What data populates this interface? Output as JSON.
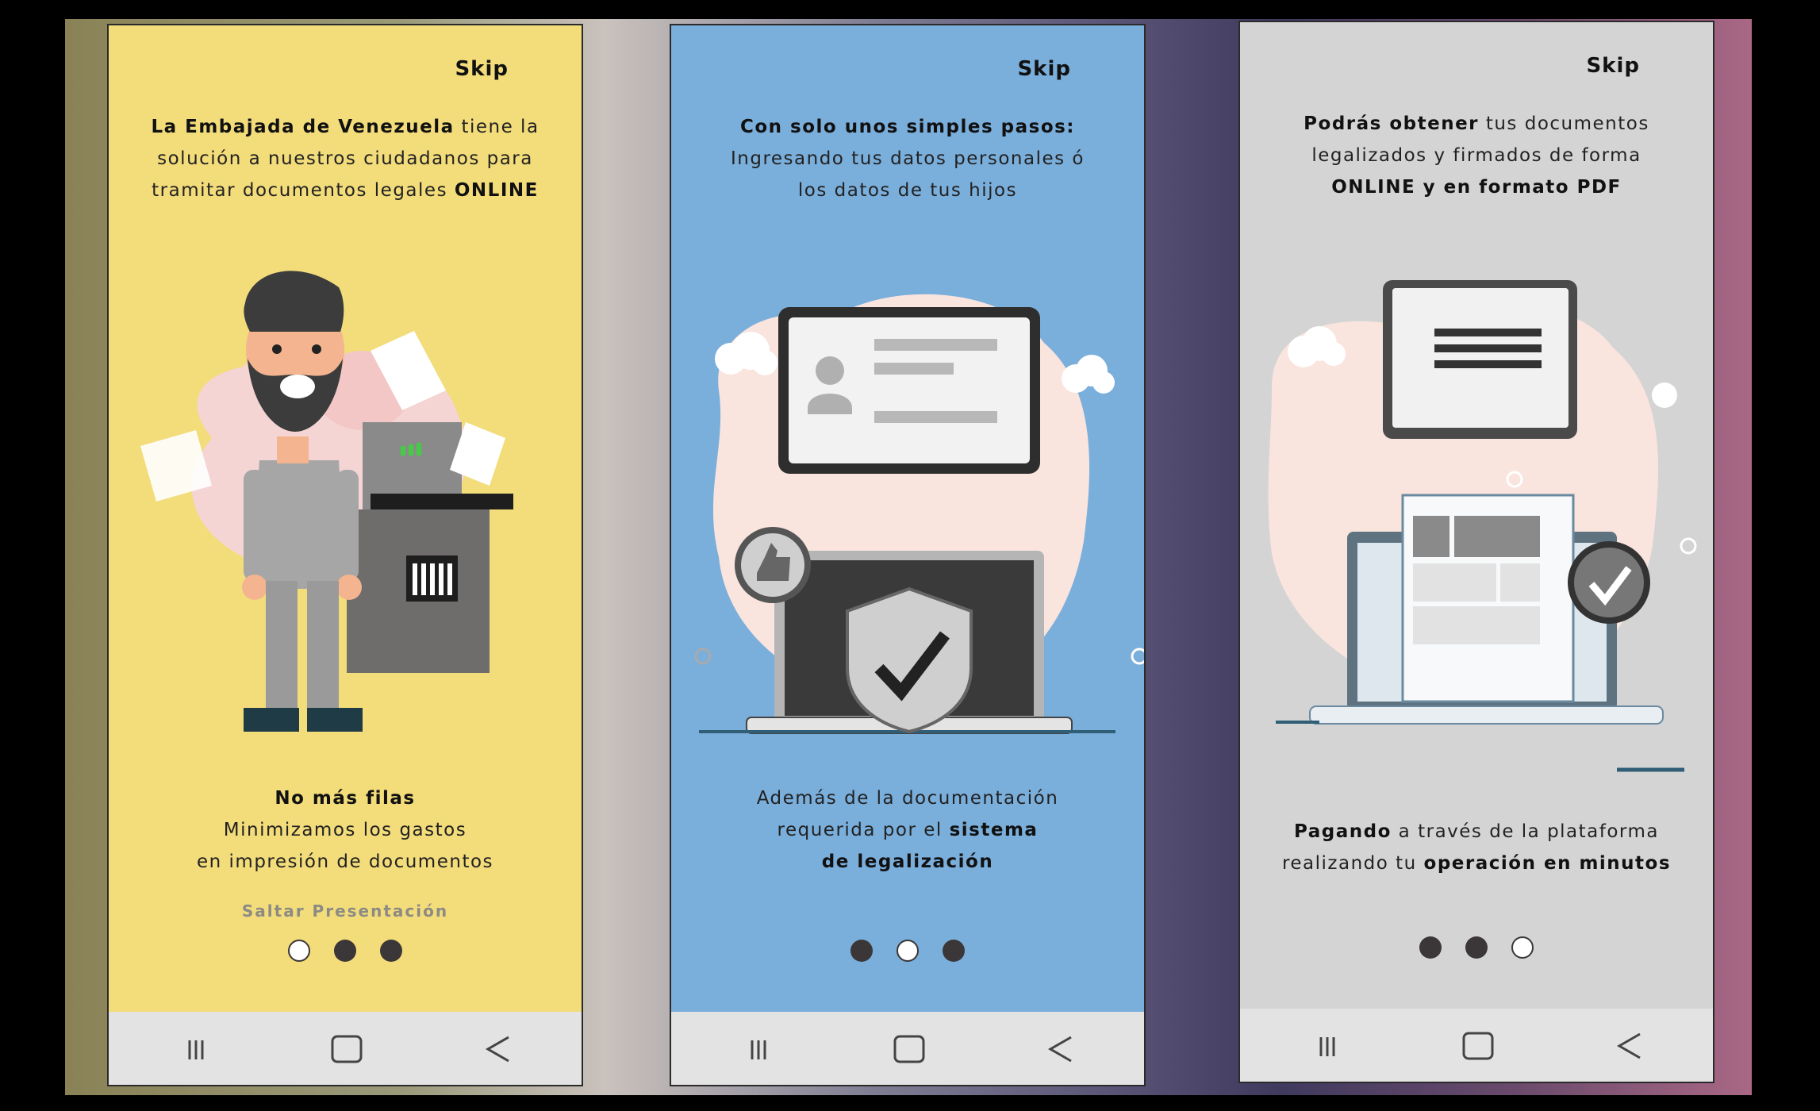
{
  "screens": [
    {
      "skip": "Skip",
      "intro": {
        "b1": "La Embajada de Venezuela",
        "t1": " tiene la solución a nuestros ciudadanos para tramitar documentos legales ",
        "b2": "ONLINE"
      },
      "outro": {
        "b1": "No más filas",
        "l2": "Minimizamos los gastos",
        "l3": "en impresión de documentos"
      },
      "skip_presentation": "Saltar Presentación",
      "active_dot": 0,
      "bg": "#f3dc7a"
    },
    {
      "skip": "Skip",
      "intro": {
        "b1": "Con solo unos simples pasos:",
        "l2": "Ingresando tus datos personales ó",
        "l3": "los datos de tus hijos"
      },
      "outro": {
        "l1": "Además de la documentación",
        "t2": "requerida por el ",
        "b2": "sistema",
        "b3": "de legalización"
      },
      "active_dot": 1,
      "bg": "#7aaedb"
    },
    {
      "skip": "Skip",
      "intro": {
        "b1": "Podrás obtener",
        "t1": " tus documentos",
        "l2": "legalizados y firmados de forma",
        "b3": "ONLINE y en formato PDF"
      },
      "outro": {
        "b1": "Pagando",
        "t1": " a través de la plataforma",
        "t2": "realizando tu ",
        "b2": "operación en minutos"
      },
      "active_dot": 2,
      "bg": "#d4d4d4"
    }
  ],
  "icons": {
    "nav_recent": "recent-apps-icon",
    "nav_home": "home-icon",
    "nav_back": "back-icon"
  }
}
